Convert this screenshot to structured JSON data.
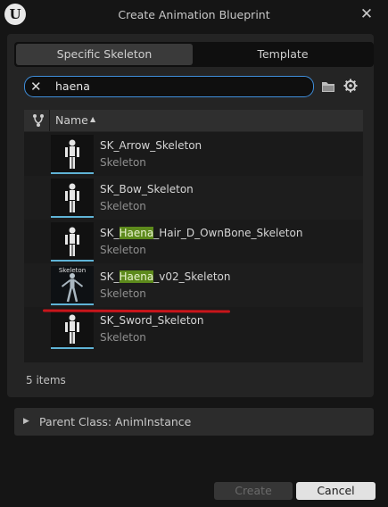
{
  "window": {
    "title": "Create Animation Blueprint",
    "logo_glyph": "U"
  },
  "tabs": [
    {
      "label": "Specific Skeleton",
      "active": true
    },
    {
      "label": "Template",
      "active": false
    }
  ],
  "search": {
    "value": "haena",
    "clear_icon": "close-icon"
  },
  "table": {
    "column_name": "Name"
  },
  "items": [
    {
      "name_pre": "SK_Arrow_Skeleton",
      "name_hl": "",
      "name_post": "",
      "type": "Skeleton",
      "thumb_label": ""
    },
    {
      "name_pre": "SK_Bow_Skeleton",
      "name_hl": "",
      "name_post": "",
      "type": "Skeleton",
      "thumb_label": ""
    },
    {
      "name_pre": "SK_",
      "name_hl": "Haena",
      "name_post": "_Hair_D_OwnBone_Skeleton",
      "type": "Skeleton",
      "thumb_label": ""
    },
    {
      "name_pre": "SK_",
      "name_hl": "Haena",
      "name_post": "_v02_Skeleton",
      "type": "Skeleton",
      "thumb_label": "Skeleton"
    },
    {
      "name_pre": "SK_Sword_Skeleton",
      "name_hl": "",
      "name_post": "",
      "type": "Skeleton",
      "thumb_label": ""
    }
  ],
  "item_count": "5 items",
  "parent_class": "Parent Class: AnimInstance",
  "buttons": {
    "create": "Create",
    "cancel": "Cancel"
  },
  "colors": {
    "accent": "#3f8edb",
    "highlight": "#5d8a1c",
    "annotation": "#c8151b",
    "thumb_bar": "#5fb3d6"
  }
}
